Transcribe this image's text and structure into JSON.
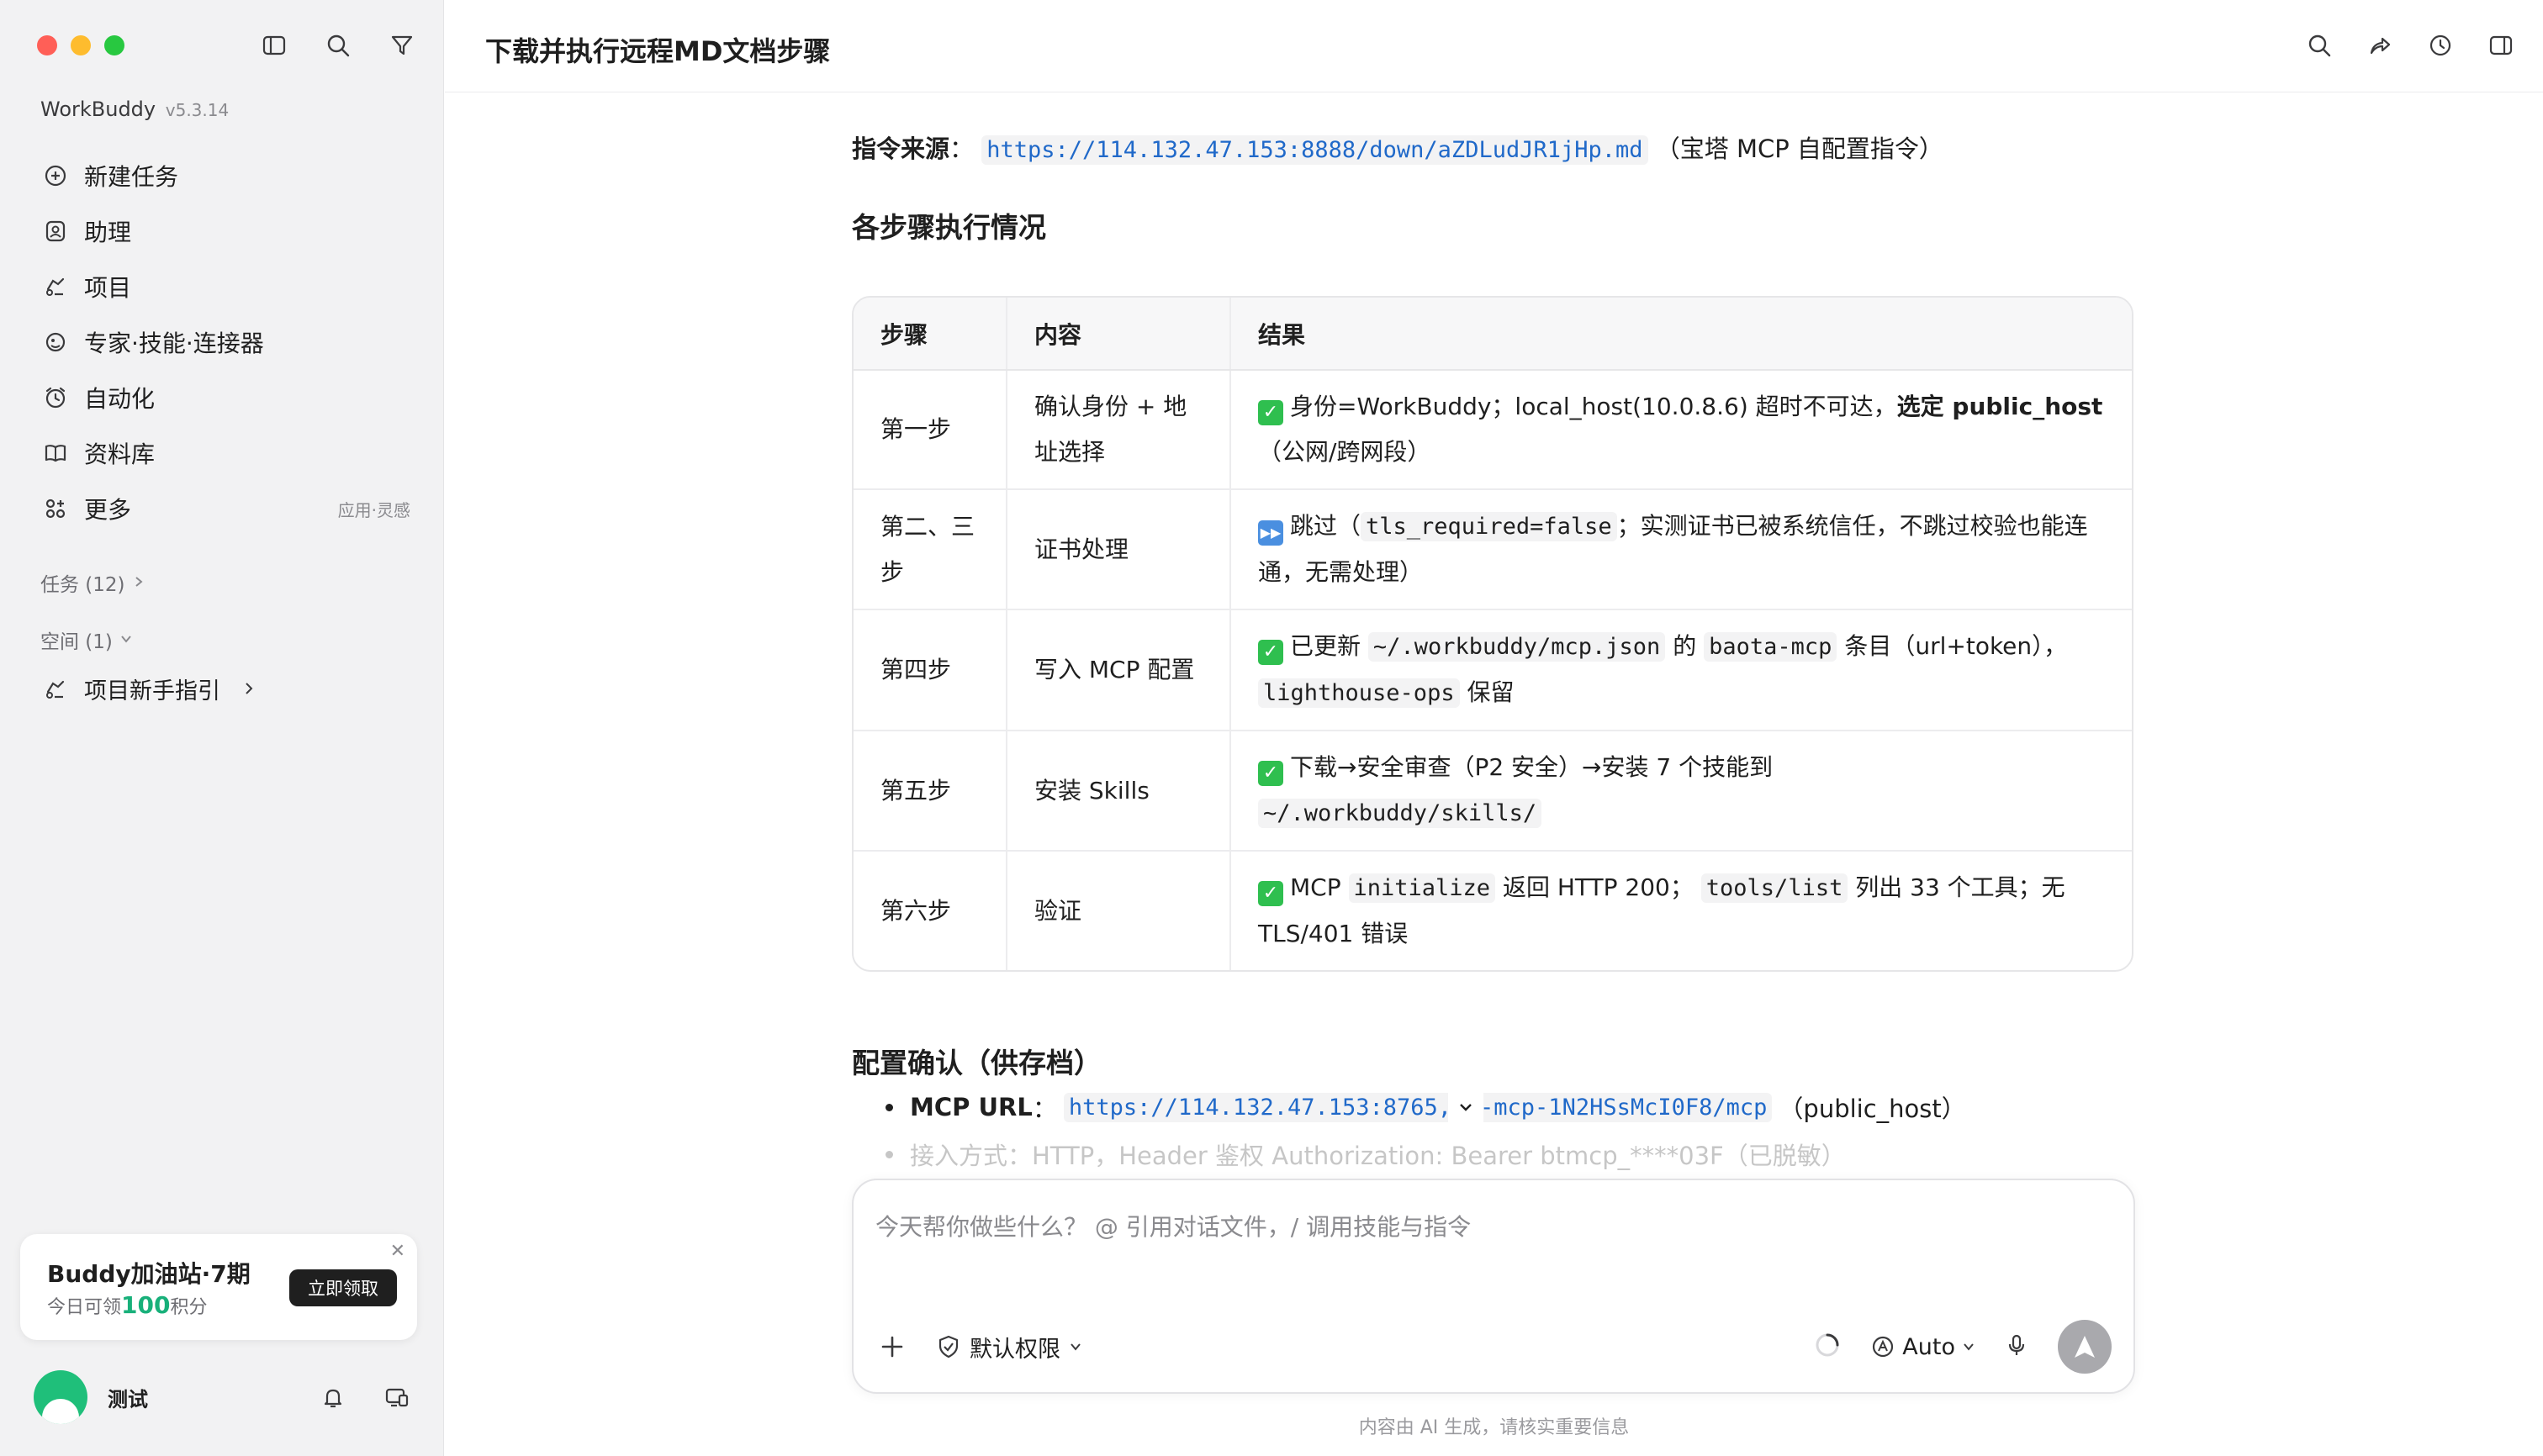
{
  "app": {
    "brand": "WorkBuddy",
    "version": "v5.3.14",
    "page_title": "下载并执行远程MD文档步骤"
  },
  "sidebar": {
    "items": [
      {
        "label": "新建任务",
        "icon": "plus-circle-icon"
      },
      {
        "label": "助理",
        "icon": "assistant-icon"
      },
      {
        "label": "项目",
        "icon": "project-icon"
      },
      {
        "label": "专家·技能·连接器",
        "icon": "expert-icon"
      },
      {
        "label": "自动化",
        "icon": "alarm-icon"
      },
      {
        "label": "资料库",
        "icon": "book-icon"
      },
      {
        "label": "更多",
        "icon": "grid-plus-icon",
        "extra": "应用·灵感"
      }
    ],
    "tasks_label": "任务 (12)",
    "space_label": "空间 (1)",
    "project_guide": "项目新手指引"
  },
  "promo": {
    "title": "Buddy加油站·7期",
    "sub_prefix": "今日可领",
    "sub_num": "100",
    "sub_suffix": "积分",
    "button": "立即领取",
    "close": "✕"
  },
  "user": {
    "name": "测试"
  },
  "content": {
    "source_label": "指令来源",
    "source_colon": "：",
    "source_url": "https://114.132.47.153:8888/down/aZDLudJR1jHp.md",
    "source_note": "（宝塔 MCP 自配置指令）",
    "steps_heading": "各步骤执行情况",
    "table": {
      "headers": [
        "步骤",
        "内容",
        "结果"
      ],
      "rows": [
        {
          "step": "第一步",
          "content": "确认身份 + 地址选择",
          "r1": "身份=WorkBuddy；local_host(10.0.8.6) 超时不可达，",
          "r1_bold": "选定 public_host",
          "r2": "（公网/跨网段）"
        },
        {
          "step": "第二、三步",
          "content": "证书处理",
          "r1": "跳过（",
          "code1": "tls_required=false",
          "r2": "；实测证书已被系统信任，不跳过校验也能连通，无需处理）"
        },
        {
          "step": "第四步",
          "content": "写入 MCP 配置",
          "r1": "已更新",
          "code1": "~/.workbuddy/mcp.json",
          "r2": "的",
          "code2": "baota-mcp",
          "r3": "条目（url+token），",
          "code3": "lighthouse-ops",
          "r4": "保留"
        },
        {
          "step": "第五步",
          "content": "安装 Skills",
          "r1": "下载→安全审查（P2 安全）→安装 7 个技能到",
          "code1": "~/.workbuddy/skills/"
        },
        {
          "step": "第六步",
          "content": "验证",
          "r1": "MCP",
          "code1": "initialize",
          "r2": "返回 HTTP 200；",
          "code2": "tools/list",
          "r3": "列出 33 个工具；无 TLS/401 错误"
        }
      ]
    },
    "config_heading": "配置确认（供存档）",
    "mcp_url_label": "MCP URL",
    "mcp_url_colon": "：",
    "mcp_url_a": "https://114.132.47.153:8765,",
    "mcp_url_b": "-mcp-1N2HSsMcI0F8/mcp",
    "mcp_url_note": "（public_host）",
    "auth_line": "接入方式：HTTP，Header 鉴权 Authorization: Bearer btmcp_****03F（已脱敏）"
  },
  "composer": {
    "placeholder": "今天帮你做些什么？ @ 引用对话文件，/ 调用技能与指令",
    "permission": "默认权限",
    "model": "Auto"
  },
  "footer": "内容由 AI 生成，请核实重要信息"
}
